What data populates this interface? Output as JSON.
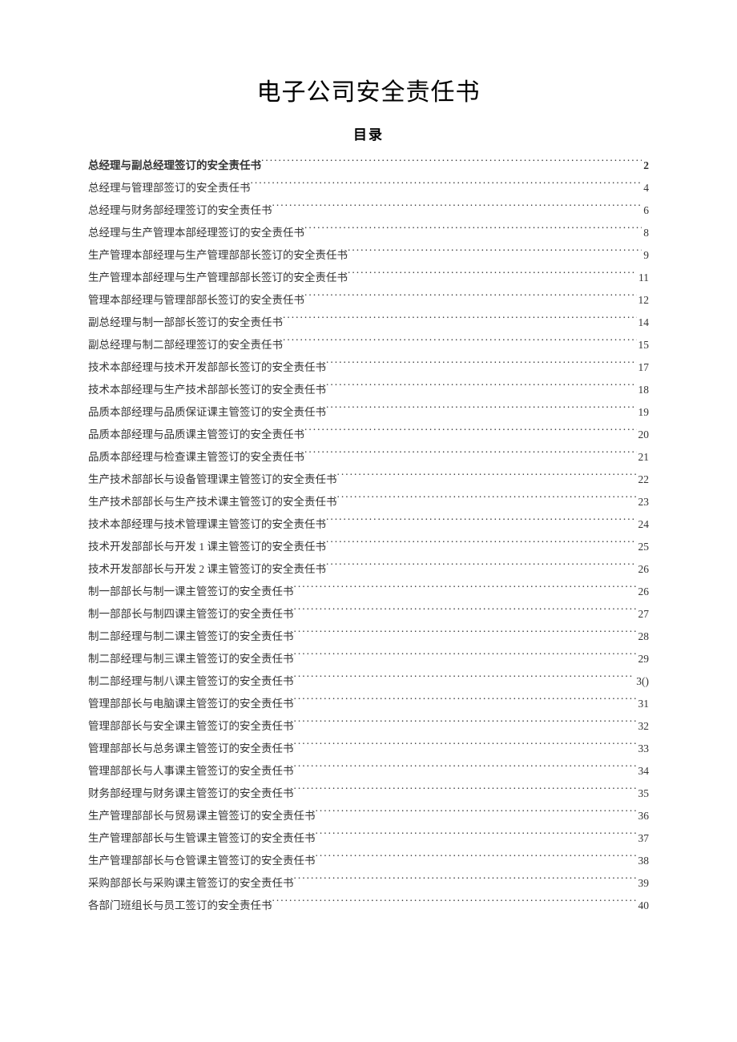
{
  "title": "电子公司安全责任书",
  "subtitle": "目录",
  "toc": [
    {
      "label": "总经理与副总经理签订的安全责任书",
      "page": "2",
      "bold": true
    },
    {
      "label": "总经理与管理部签订的安全责任书",
      "page": "4",
      "bold": false
    },
    {
      "label": "总经理与财务部经理签订的安全责任书",
      "page": "6",
      "bold": false
    },
    {
      "label": "总经理与生产管理本部经理签订的安全责任书",
      "page": "8",
      "bold": false
    },
    {
      "label": "生产管理本部经理与生产管理部部长签订的安全责任书",
      "page": "9",
      "bold": false
    },
    {
      "label": "生产管理本部经理与生产管理部部长签订的安全责任书",
      "page": "11",
      "bold": false
    },
    {
      "label": "管理本部经理与管理部部长签订的安全责任书",
      "page": "12",
      "bold": false
    },
    {
      "label": "副总经理与制一部部长签订的安全责任书",
      "page": "14",
      "bold": false
    },
    {
      "label": "副总经理与制二部经理签订的安全责任书",
      "page": "15",
      "bold": false
    },
    {
      "label": "技术本部经理与技术开发部部长签订的安全责任书",
      "page": "17",
      "bold": false
    },
    {
      "label": "技术本部经理与生产技术部部长签订的安全责任书",
      "page": "18",
      "bold": false
    },
    {
      "label": "品质本部经理与品质保证课主管签订的安全责任书",
      "page": "19",
      "bold": false
    },
    {
      "label": "品质本部经理与品质课主管签订的安全责任书",
      "page": "20",
      "bold": false
    },
    {
      "label": "品质本部经理与检查课主管签订的安全责任书",
      "page": "21",
      "bold": false
    },
    {
      "label": "生产技术部部长与设备管理课主管签订的安全责任书",
      "page": "22",
      "bold": false
    },
    {
      "label": "生产技术部部长与生产技术课主管签订的安全责任书",
      "page": "23",
      "bold": false
    },
    {
      "label": "技术本部经理与技术管理课主管签订的安全责任书",
      "page": "24",
      "bold": false
    },
    {
      "label": "技术开发部部长与开发 1 课主管签订的安全责任书",
      "page": "25",
      "bold": false
    },
    {
      "label": "技术开发部部长与开发 2 课主管签订的安全责任书",
      "page": "26",
      "bold": false
    },
    {
      "label": "制一部部长与制一课主管签订的安全责任书",
      "page": "26",
      "bold": false
    },
    {
      "label": "制一部部长与制四课主管签订的安全责任书",
      "page": "27",
      "bold": false
    },
    {
      "label": "制二部经理与制二课主管签订的安全责任书",
      "page": "28",
      "bold": false
    },
    {
      "label": "制二部经理与制三课主管签订的安全责任书",
      "page": "29",
      "bold": false
    },
    {
      "label": "制二部经理与制八课主管签订的安全责任书 ",
      "page": "3()",
      "bold": false
    },
    {
      "label": "管理部部长与电脑课主管签订的安全责任书",
      "page": "31",
      "bold": false
    },
    {
      "label": "管理部部长与安全课主管签订的安全责任书",
      "page": "32",
      "bold": false
    },
    {
      "label": "管理部部长与总务课主管签订的安全责任书",
      "page": "33",
      "bold": false
    },
    {
      "label": "管理部部长与人事课主管签订的安全责任书",
      "page": "34",
      "bold": false
    },
    {
      "label": "财务部经理与财务课主管签订的安全责任书",
      "page": "35",
      "bold": false
    },
    {
      "label": "生产管理部部长与贸易课主管签订的安全责任书",
      "page": "36",
      "bold": false
    },
    {
      "label": "生产管理部部长与生管课主管签订的安全责任书",
      "page": "37",
      "bold": false
    },
    {
      "label": "生产管理部部长与仓管课主管签订的安全责任书",
      "page": "38",
      "bold": false
    },
    {
      "label": "采购部部长与采购课主管签订的安全责任书",
      "page": "39",
      "bold": false
    },
    {
      "label": "各部门班组长与员工签订的安全责任书",
      "page": "40",
      "bold": false
    }
  ]
}
